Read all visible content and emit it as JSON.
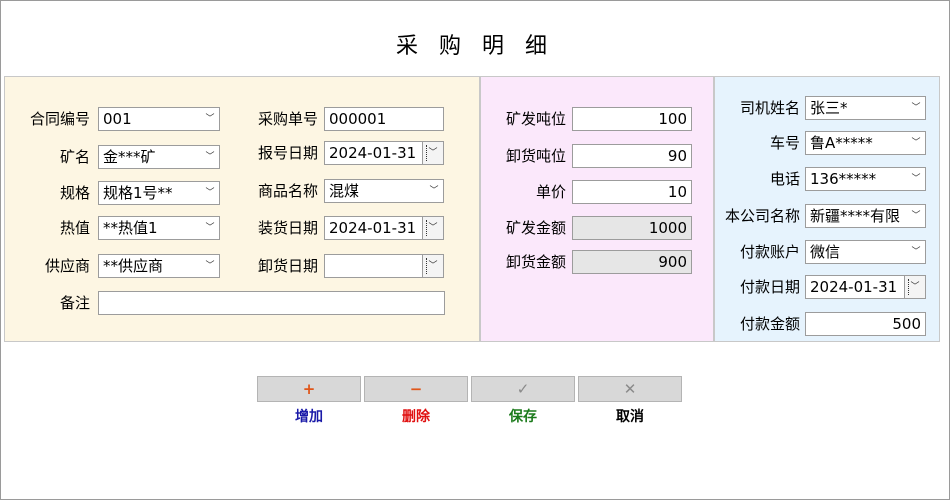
{
  "title": "采 购 明 细",
  "left": {
    "contract_no": {
      "label": "合同编号",
      "value": "001"
    },
    "mine_name": {
      "label": "矿名",
      "value": "金***矿"
    },
    "spec": {
      "label": "规格",
      "value": "规格1号**"
    },
    "heat_value": {
      "label": "热值",
      "value": "**热值1"
    },
    "supplier": {
      "label": "供应商",
      "value": "**供应商"
    },
    "remark": {
      "label": "备注",
      "value": ""
    },
    "purchase_no": {
      "label": "采购单号",
      "value": "000001"
    },
    "report_date": {
      "label": "报号日期",
      "value": "2024-01-31"
    },
    "product_name": {
      "label": "商品名称",
      "value": "混煤"
    },
    "load_date": {
      "label": "装货日期",
      "value": "2024-01-31"
    },
    "unload_date": {
      "label": "卸货日期",
      "value": ""
    }
  },
  "middle": {
    "mine_tonnage": {
      "label": "矿发吨位",
      "value": "100"
    },
    "unload_tonnage": {
      "label": "卸货吨位",
      "value": "90"
    },
    "unit_price": {
      "label": "单价",
      "value": "10"
    },
    "mine_amount": {
      "label": "矿发金额",
      "value": "1000"
    },
    "unload_amount": {
      "label": "卸货金额",
      "value": "900"
    }
  },
  "right": {
    "driver_name": {
      "label": "司机姓名",
      "value": "张三*"
    },
    "plate_no": {
      "label": "车号",
      "value": "鲁A*****"
    },
    "phone": {
      "label": "电话",
      "value": "136*****"
    },
    "company_name": {
      "label": "本公司名称",
      "value": "新疆****有限"
    },
    "pay_account": {
      "label": "付款账户",
      "value": "微信"
    },
    "pay_date": {
      "label": "付款日期",
      "value": "2024-01-31"
    },
    "pay_amount": {
      "label": "付款金额",
      "value": "500"
    }
  },
  "buttons": {
    "add": {
      "icon": "+",
      "label": "增加",
      "icon_color": "#e0561a",
      "label_color": "#1a1aa8"
    },
    "delete": {
      "icon": "−",
      "label": "删除",
      "icon_color": "#e0561a",
      "label_color": "#e01010"
    },
    "save": {
      "icon": "✓",
      "label": "保存",
      "icon_color": "#8a8a8a",
      "label_color": "#1a7a1a"
    },
    "cancel": {
      "icon": "✕",
      "label": "取消",
      "icon_color": "#8a8a8a",
      "label_color": "#000000"
    }
  }
}
